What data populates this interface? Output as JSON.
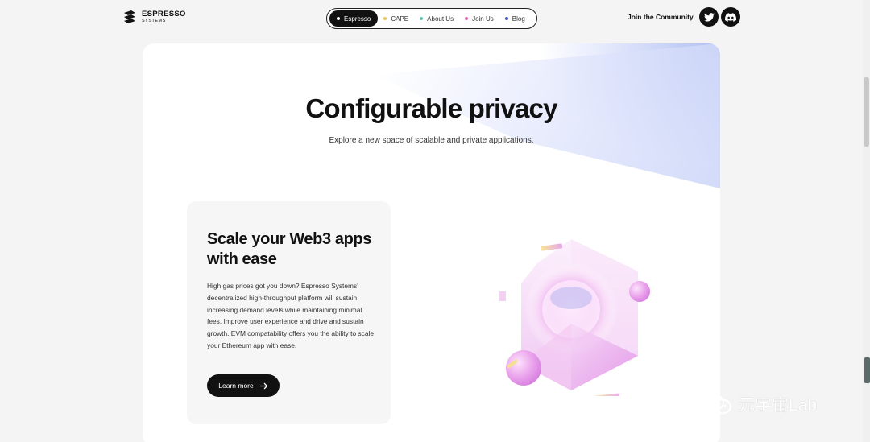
{
  "brand": {
    "name": "ESPRESSO",
    "sub": "SYSTEMS"
  },
  "nav": {
    "items": [
      {
        "label": "Espresso",
        "dot": "#ffffff",
        "active": true
      },
      {
        "label": "CAPE",
        "dot": "#e8c84a"
      },
      {
        "label": "About Us",
        "dot": "#5fc9b8"
      },
      {
        "label": "Join Us",
        "dot": "#e95fb4"
      },
      {
        "label": "Blog",
        "dot": "#3f51d6"
      }
    ]
  },
  "community": {
    "label": "Join the Community",
    "twitter_icon": "twitter-icon",
    "discord_icon": "discord-icon"
  },
  "hero": {
    "title": "Configurable privacy",
    "subtitle": "Explore a new space of scalable and private applications."
  },
  "feature": {
    "title": "Scale your Web3 apps with ease",
    "body": "High gas prices got you down? Espresso Systems' decentralized high-throughput platform will sustain increasing demand levels while maintaining minimal fees. Improve user experience and drive and sustain growth. EVM compatability offers you the ability to scale your Ethereum app with ease.",
    "button_label": "Learn more"
  },
  "watermark": {
    "text": "元宇宙Lab"
  },
  "colors": {
    "accent": "#111111",
    "glow": "#b9c4f2",
    "art_pink": "#e9a6ec"
  }
}
